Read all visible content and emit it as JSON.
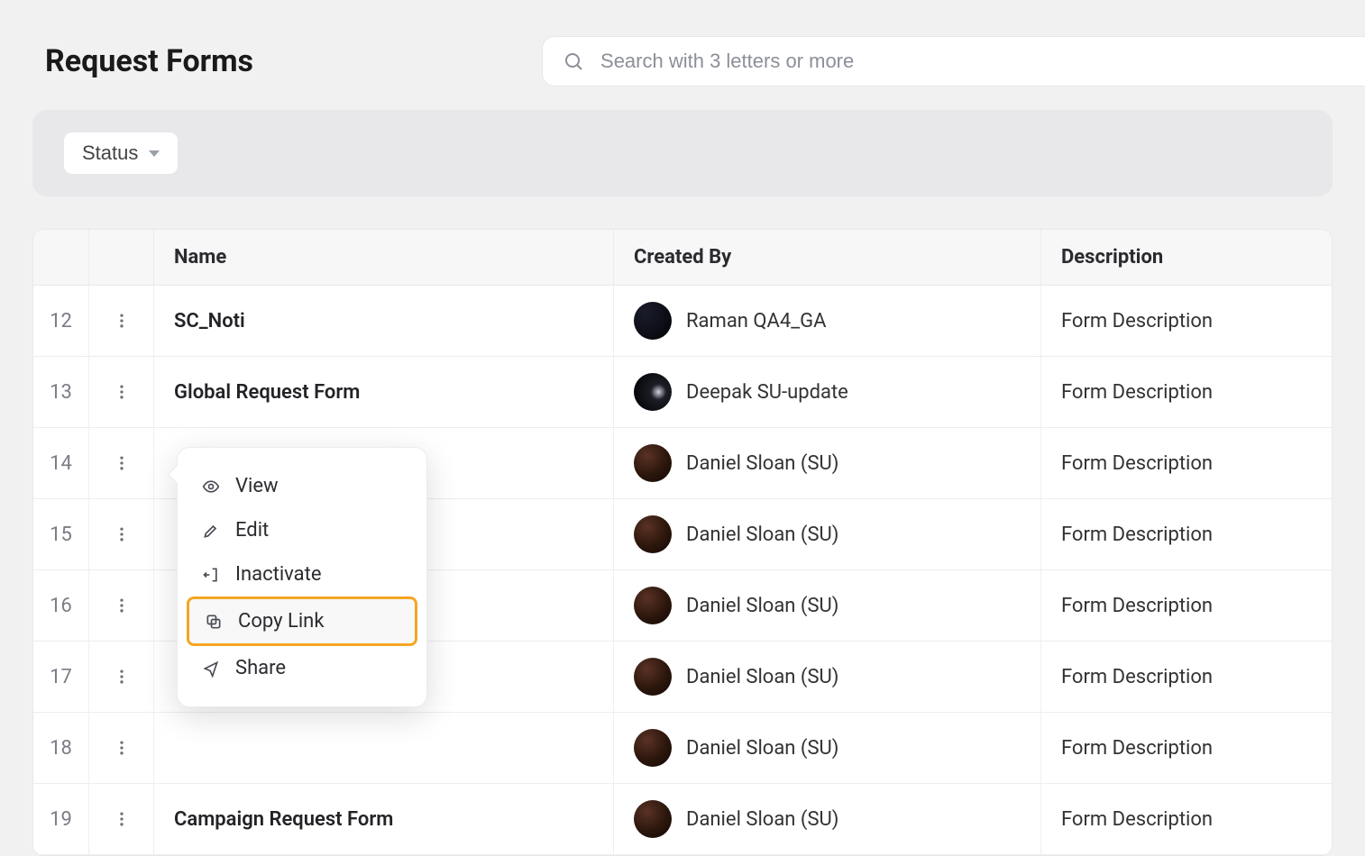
{
  "header": {
    "title": "Request Forms",
    "search_placeholder": "Search with 3 letters or more"
  },
  "filters": {
    "status_label": "Status"
  },
  "table": {
    "columns": {
      "name": "Name",
      "created_by": "Created By",
      "description": "Description"
    },
    "rows": [
      {
        "idx": "12",
        "name": "SC_Noti",
        "created_by": "Raman QA4_GA",
        "avatar_class": "dark",
        "description": "Form Description"
      },
      {
        "idx": "13",
        "name": "Global Request Form",
        "created_by": "Deepak SU-update",
        "avatar_class": "dark2",
        "description": "Form Description"
      },
      {
        "idx": "14",
        "name": "",
        "created_by": "Daniel Sloan (SU)",
        "avatar_class": "",
        "description": "Form Description"
      },
      {
        "idx": "15",
        "name": "",
        "created_by": "Daniel Sloan (SU)",
        "avatar_class": "",
        "description": "Form Description"
      },
      {
        "idx": "16",
        "name": "",
        "created_by": "Daniel Sloan (SU)",
        "avatar_class": "",
        "description": "Form Description"
      },
      {
        "idx": "17",
        "name": "",
        "created_by": "Daniel Sloan (SU)",
        "avatar_class": "",
        "description": "Form Description"
      },
      {
        "idx": "18",
        "name": "",
        "created_by": "Daniel Sloan (SU)",
        "avatar_class": "",
        "description": "Form Description"
      },
      {
        "idx": "19",
        "name": "Campaign Request Form",
        "created_by": "Daniel Sloan (SU)",
        "avatar_class": "",
        "description": "Form Description"
      }
    ]
  },
  "context_menu": {
    "items": [
      {
        "label": "View",
        "icon": "eye-icon",
        "highlight": false
      },
      {
        "label": "Edit",
        "icon": "pencil-icon",
        "highlight": false
      },
      {
        "label": "Inactivate",
        "icon": "logout-icon",
        "highlight": false
      },
      {
        "label": "Copy Link",
        "icon": "copy-icon",
        "highlight": true
      },
      {
        "label": "Share",
        "icon": "share-icon",
        "highlight": false
      }
    ]
  }
}
